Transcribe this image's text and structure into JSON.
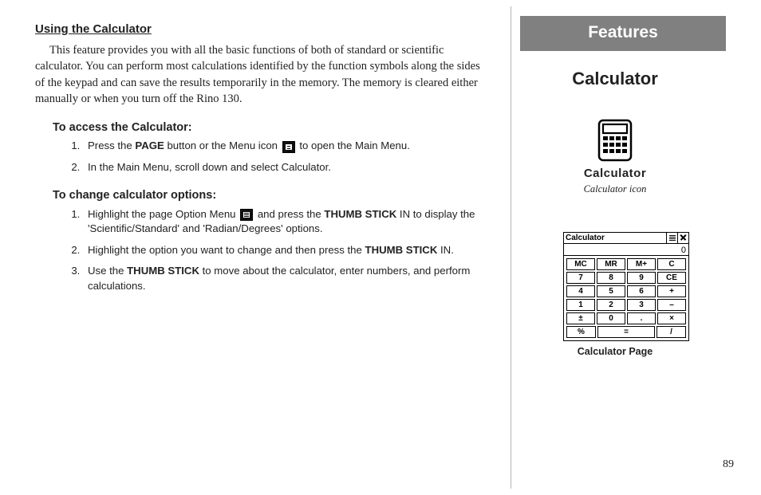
{
  "header": {
    "features_tab": "Features",
    "page_title": "Calculator"
  },
  "left": {
    "section_title": "Using the Calculator",
    "intro": "This feature provides you with all the basic functions of both of standard or scientific calculator.  You can perform most calculations identified by the function symbols along the sides of the keypad and can save the results temporarily in the memory.  The memory is cleared either manually or when you turn off the Rino 130.",
    "proc1_title": "To access the Calculator:",
    "proc1": {
      "s1a": "Press the ",
      "s1_page": "PAGE",
      "s1b": " button or the Menu icon ",
      "s1c": " to open the Main Menu.",
      "s2": "In the Main Menu, scroll down and select Calculator."
    },
    "proc2_title": "To change calculator options:",
    "proc2": {
      "s1a": "Highlight the page Option Menu ",
      "s1b": " and press the ",
      "s1_ts": "THUMB STICK",
      "s1c": " IN to display the 'Scientific/Standard' and 'Radian/Degrees' options.",
      "s2a": "Highlight the option you want to change and then press the ",
      "s2b": " IN.",
      "s3a": "Use the ",
      "s3b": " to move about the calculator, enter numbers, and perform calculations."
    }
  },
  "icon": {
    "label": "Calculator",
    "caption": "Calculator icon"
  },
  "calc_screen": {
    "title": "Calculator",
    "display": "0",
    "rows": [
      [
        "MC",
        "MR",
        "M+",
        "C"
      ],
      [
        "7",
        "8",
        "9",
        "CE"
      ],
      [
        "4",
        "5",
        "6",
        "+"
      ],
      [
        "1",
        "2",
        "3",
        "–"
      ],
      [
        "±",
        "0",
        ".",
        "×"
      ],
      [
        "%",
        "=",
        "/"
      ]
    ],
    "caption": "Calculator Page"
  },
  "page_number": "89"
}
